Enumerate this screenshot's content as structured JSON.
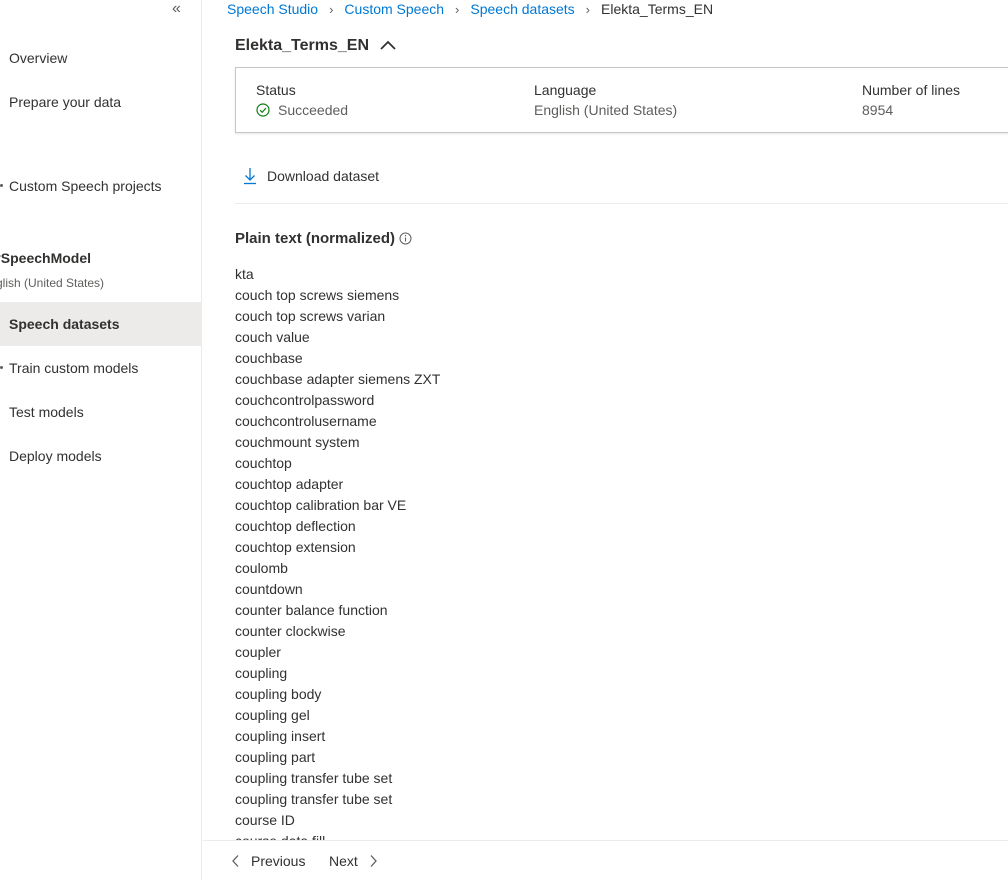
{
  "sidebar": {
    "collapse_glyph": "«",
    "items": [
      {
        "label": "Overview"
      },
      {
        "label": "Prepare your data"
      },
      {
        "label": "Custom Speech projects"
      },
      {
        "label": "Speech datasets"
      },
      {
        "label": "Train custom models"
      },
      {
        "label": "Test models"
      },
      {
        "label": "Deploy models"
      }
    ],
    "model": {
      "name": "ySpeechModel",
      "language": "glish (United States)"
    }
  },
  "breadcrumb": {
    "items": [
      "Speech Studio",
      "Custom Speech",
      "Speech datasets"
    ],
    "current": "Elekta_Terms_EN"
  },
  "dataset": {
    "title": "Elekta_Terms_EN",
    "status_label": "Status",
    "status_value": "Succeeded",
    "language_label": "Language",
    "language_value": "English (United States)",
    "lines_label": "Number of lines",
    "lines_value": "8954"
  },
  "actions": {
    "download_label": "Download dataset"
  },
  "content": {
    "section_title": "Plain text (normalized)",
    "lines": [
      "kta",
      "couch top screws siemens",
      "couch top screws varian",
      "couch value",
      "couchbase",
      "couchbase adapter siemens ZXT",
      "couchcontrolpassword",
      "couchcontrolusername",
      "couchmount system",
      "couchtop",
      "couchtop adapter",
      "couchtop calibration bar VE",
      "couchtop deflection",
      "couchtop extension",
      "coulomb",
      "countdown",
      "counter balance function",
      "counter clockwise",
      "coupler",
      "coupling",
      "coupling body",
      "coupling gel",
      "coupling insert",
      "coupling part",
      "coupling transfer tube set",
      "coupling transfer tube set",
      "course ID",
      "course data fill"
    ]
  },
  "pager": {
    "previous_label": "Previous",
    "next_label": "Next"
  },
  "colors": {
    "accent": "#0078d4",
    "success": "#107c10",
    "selected_bg": "#edebe9"
  }
}
